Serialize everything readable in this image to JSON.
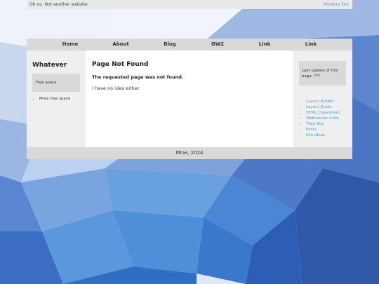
{
  "topbar": {
    "left_text": "Oh no. Not another website.",
    "right_link": "Mystery link"
  },
  "nav": {
    "items": [
      "Home",
      "About",
      "Blog",
      "GW2",
      "Link",
      "Link"
    ]
  },
  "sidebar_left": {
    "title": "Whatever",
    "box_text": "Free space",
    "list": [
      "More free space"
    ]
  },
  "main": {
    "title": "Page Not Found",
    "message": "The requested page was not found.",
    "note": "I have no idea either."
  },
  "sidebar_right": {
    "update_text": "Last update of this page: ???",
    "links": [
      "Layout Builder",
      "Layout Guide",
      "HTML Cheatsheet",
      "Webmaster Links",
      "Tiled BGs",
      "Fonts",
      "Site Ideas"
    ]
  },
  "footer": {
    "text": "Mine, 2024"
  },
  "colors": {
    "link": "#4aa0d4",
    "background": "#3f73c0"
  }
}
